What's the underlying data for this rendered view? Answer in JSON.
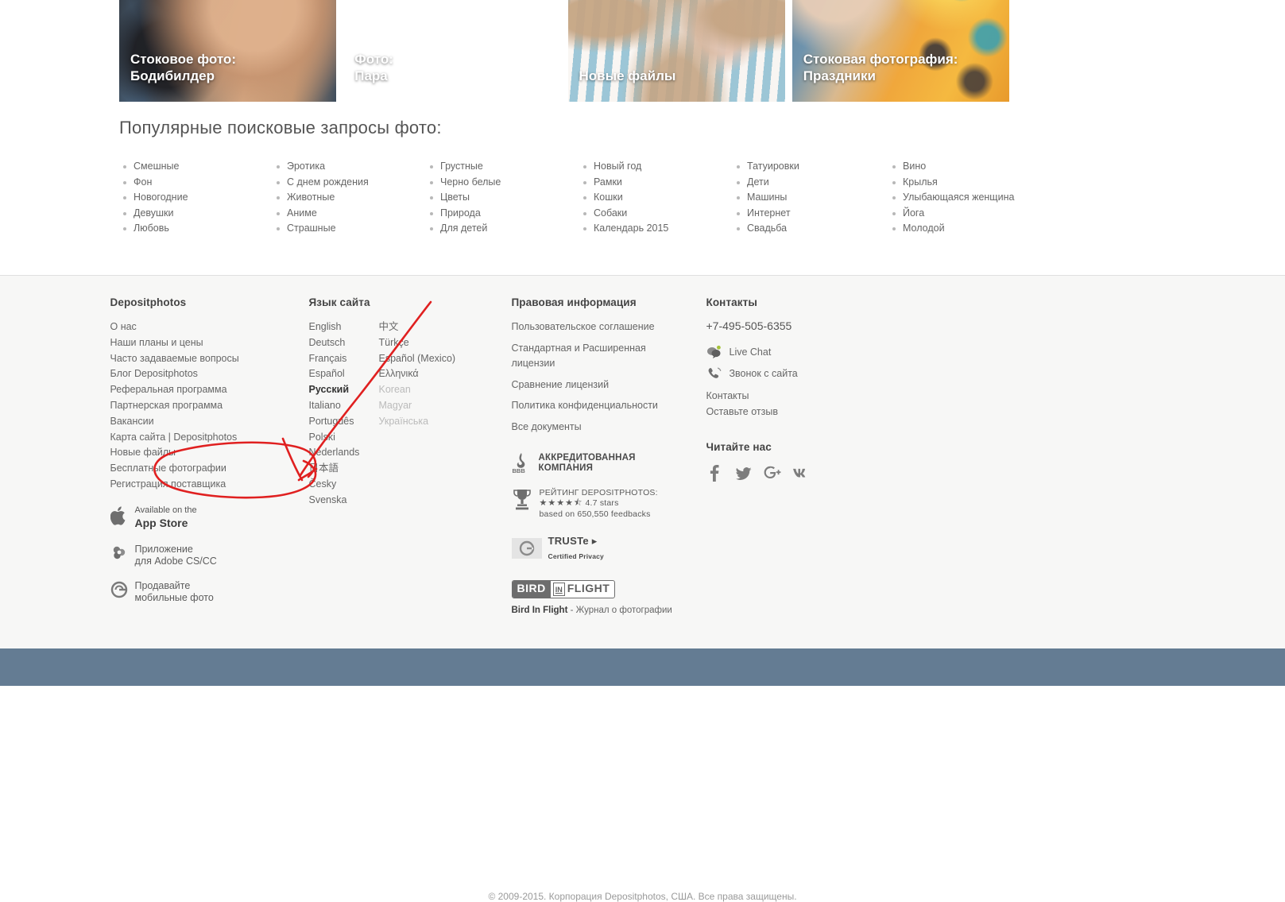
{
  "banners": [
    {
      "id": "bodybuilder",
      "caption": "Стоковое фото:\nБодибилдер"
    },
    {
      "id": "couple",
      "caption": "Фото:\nПара"
    },
    {
      "id": "new-files",
      "caption": "Новые файлы"
    },
    {
      "id": "holidays",
      "caption": "Стоковая фотография:\nПраздники"
    }
  ],
  "popular": {
    "title": "Популярные поисковые запросы фото:",
    "columns": [
      [
        "Смешные",
        "Фон",
        "Новогодние",
        "Девушки",
        "Любовь"
      ],
      [
        "Эротика",
        "С днем рождения",
        "Животные",
        "Аниме",
        "Страшные"
      ],
      [
        "Грустные",
        "Черно белые",
        "Цветы",
        "Природа",
        "Для детей"
      ],
      [
        "Новый год",
        "Рамки",
        "Кошки",
        "Собаки",
        "Календарь 2015"
      ],
      [
        "Татуировки",
        "Дети",
        "Машины",
        "Интернет",
        "Свадьба"
      ],
      [
        "Вино",
        "Крылья",
        "Улыбающаяся женщина",
        "Йога",
        "Молодой"
      ]
    ]
  },
  "footer": {
    "company": {
      "heading": "Depositphotos",
      "links": [
        "О нас",
        "Наши планы и цены",
        "Часто задаваемые вопросы",
        "Блог Depositphotos",
        "Реферальная программа",
        "Партнерская программа",
        "Вакансии",
        "Карта сайта | Depositphotos",
        "Новые файлы",
        "Бесплатные фотографии",
        "Регистрация поставщика"
      ],
      "appstore": {
        "line1": "Available on the",
        "line2": "App Store",
        "icon": "apple-icon"
      },
      "adobe": {
        "line1": "Приложение",
        "line2": "для Adobe CS/CC",
        "icon": "adobe-plugin-icon"
      },
      "mobile": {
        "line1": "Продавайте",
        "line2": "мобильные фото",
        "icon": "clashot-icon"
      }
    },
    "language": {
      "heading": "Язык сайта",
      "col_left": [
        {
          "label": "English",
          "state": "normal"
        },
        {
          "label": "Deutsch",
          "state": "normal"
        },
        {
          "label": "Français",
          "state": "normal"
        },
        {
          "label": "Español",
          "state": "normal"
        },
        {
          "label": "Русский",
          "state": "current"
        },
        {
          "label": "Italiano",
          "state": "normal"
        },
        {
          "label": "Português",
          "state": "normal"
        },
        {
          "label": "Polski",
          "state": "normal"
        },
        {
          "label": "Nederlands",
          "state": "normal"
        },
        {
          "label": "日本語",
          "state": "normal"
        },
        {
          "label": "Česky",
          "state": "normal"
        },
        {
          "label": "Svenska",
          "state": "normal"
        }
      ],
      "col_right": [
        {
          "label": "中文",
          "state": "normal"
        },
        {
          "label": "Türkçe",
          "state": "normal"
        },
        {
          "label": "Español (Mexico)",
          "state": "normal"
        },
        {
          "label": "Ελληνικά",
          "state": "normal"
        },
        {
          "label": "Korean",
          "state": "dim"
        },
        {
          "label": "Magyar",
          "state": "dim"
        },
        {
          "label": "Українська",
          "state": "dim"
        }
      ]
    },
    "legal": {
      "heading": "Правовая информация",
      "links": [
        "Пользовательское соглашение",
        "Стандартная и Расширенная лицензии",
        "Сравнение лицензий",
        "Политика конфиденциальности",
        "Все документы"
      ],
      "bbb": {
        "line1": "АККРЕДИТОВАННАЯ",
        "line2": "КОМПАНИЯ",
        "mark": "BBB"
      },
      "rating": {
        "title": "РЕЙТИНГ DEPOSITPHOTOS:",
        "stars": "★★★★⯪",
        "score": "4.7 stars",
        "basis": "based on 650,550 feedbacks"
      },
      "truste": {
        "line1": "TRUSTe ▸",
        "line2": "Certified Privacy"
      },
      "bird": {
        "w1": "BIRD",
        "w2": "IN",
        "w3": "FLIGHT",
        "caption_bold": "Bird In Flight",
        "caption_rest": " - Журнал о фотографии"
      }
    },
    "contacts": {
      "heading": "Контакты",
      "phone": "+7-495-505-6355",
      "live_chat": "Live Chat",
      "call_back": "Звонок с сайта",
      "links": [
        "Контакты",
        "Оставьте отзыв"
      ],
      "follow_heading": "Читайте нас",
      "social": [
        "facebook-icon",
        "twitter-icon",
        "google-plus-icon",
        "vk-icon"
      ]
    },
    "copyright": "© 2009-2015. Корпорация Depositphotos, США. Все права защищены."
  },
  "annotation": {
    "color": "#e02020",
    "shapes": "hand-drawn arrow and ellipse highlighting supplier registration link"
  }
}
